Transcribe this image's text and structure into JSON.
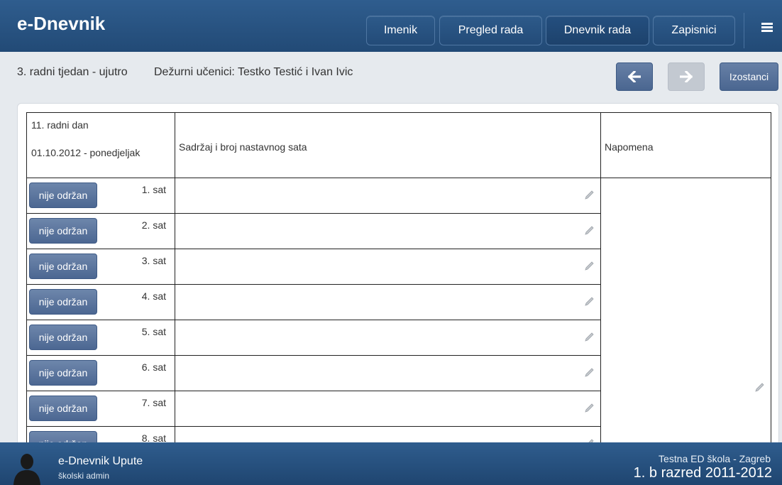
{
  "header": {
    "brand": "e-Dnevnik",
    "nav": [
      {
        "label": "Imenik"
      },
      {
        "label": "Pregled rada"
      },
      {
        "label": "Dnevnik rada"
      },
      {
        "label": "Zapisnici"
      }
    ],
    "active_nav": "Dnevnik rada",
    "menu_icon": "hamburger-menu-icon"
  },
  "subheader": {
    "week": "3. radni tjedan - ujutro",
    "duty": "Dežurni učenici: Testko Testić i Ivan Ivic",
    "prev_icon": "arrow-left-icon",
    "next_icon": "arrow-right-icon",
    "absences_label": "Izostanci"
  },
  "table": {
    "day_label": "11. radni dan",
    "date_label": "01.10.2012 - ponedjeljak",
    "content_header": "Sadržaj i broj nastavnog sata",
    "note_header": "Napomena",
    "rows": [
      {
        "button": "nije održan",
        "sat": "1. sat"
      },
      {
        "button": "nije održan",
        "sat": "2. sat"
      },
      {
        "button": "nije održan",
        "sat": "3. sat"
      },
      {
        "button": "nije održan",
        "sat": "4. sat"
      },
      {
        "button": "nije održan",
        "sat": "5. sat"
      },
      {
        "button": "nije održan",
        "sat": "6. sat"
      },
      {
        "button": "nije održan",
        "sat": "7. sat"
      },
      {
        "button": "nije održan",
        "sat": "8. sat"
      }
    ],
    "edit_icon": "pencil-icon"
  },
  "footer": {
    "title": "e-Dnevnik Upute",
    "role": "školski admin",
    "school": "Testna ED škola - Zagreb",
    "class": "1. b razred 2011-2012",
    "avatar_icon": "user-silhouette-icon"
  },
  "colors": {
    "header_bg": "#2f5d8e",
    "button_bg": "#5b769e",
    "page_bg": "#e6eaee"
  }
}
